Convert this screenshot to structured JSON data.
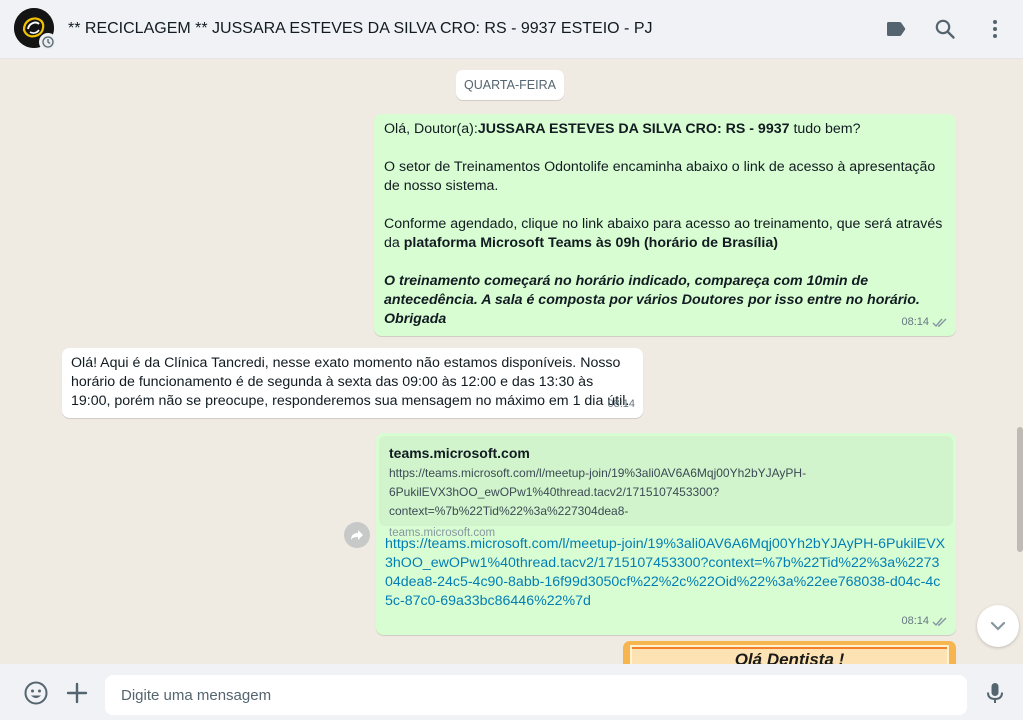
{
  "header": {
    "title": "** RECICLAGEM ** JUSSARA ESTEVES DA SILVA CRO: RS - 9937 ESTEIO  - PJ",
    "icons": [
      "label-icon",
      "search-icon",
      "menu-icon"
    ]
  },
  "chat": {
    "day_label": "QUARTA-FEIRA",
    "msg1": {
      "greeting_pre": "Olá, Doutor(a):",
      "greeting_name": "JUSSARA ESTEVES DA SILVA CRO: RS - 9937",
      "greeting_post": " tudo bem?",
      "para2": "O setor de Treinamentos Odontolife encaminha abaixo o link de acesso à apresentação de nosso sistema.",
      "para3_pre": "Conforme agendado, clique no link abaixo para acesso ao treinamento, que será através da ",
      "para3_bold": "plataforma Microsoft Teams às 09h (horário de Brasília)",
      "para4": "O treinamento começará no horário indicado, compareça com 10min de antecedência. A sala é composta por vários Doutores por isso entre no horário. Obrigada",
      "time": "08:14"
    },
    "msg2": {
      "text": "Olá! Aqui é da Clínica Tancredi, nesse exato momento não estamos disponíveis. Nosso horário de funcionamento é de segunda à sexta das 09:00 às 12:00 e das 13:30 às 19:00, porém não se preocupe, responderemos sua mensagem no máximo em 1 dia útil.",
      "time": "08:14"
    },
    "msg3": {
      "preview_title": "teams.microsoft.com",
      "preview_line1": "https://teams.microsoft.com/l/meetup-join/19%3ali0AV6A6Mqj00Yh2bYJAyPH-",
      "preview_line2": "6PukilEVX3hOO_ewOPw1%40thread.tacv2/1715107453300?context=%7b%22Tid%22%3a%227304dea8-",
      "preview_host": "teams.microsoft.com",
      "link": "https://teams.microsoft.com/l/meetup-join/19%3ali0AV6A6Mqj00Yh2bYJAyPH-6PukilEVX3hOO_ewOPw1%40thread.tacv2/1715107453300?context=%7b%22Tid%22%3a%227304dea8-24c5-4c90-8abb-16f99d3050cf%22%2c%22Oid%22%3a%22ee768038-d04c-4c5c-87c0-69a33bc86446%22%7d",
      "time": "08:14"
    },
    "msg4": {
      "banner_title": "Olá Dentista !"
    }
  },
  "footer": {
    "input_placeholder": "Digite uma mensagem"
  },
  "colors": {
    "outgoing_bubble": "#d9fdd3",
    "incoming_bubble": "#ffffff",
    "link": "#027eb5",
    "read_ticks": "#8696a0"
  }
}
